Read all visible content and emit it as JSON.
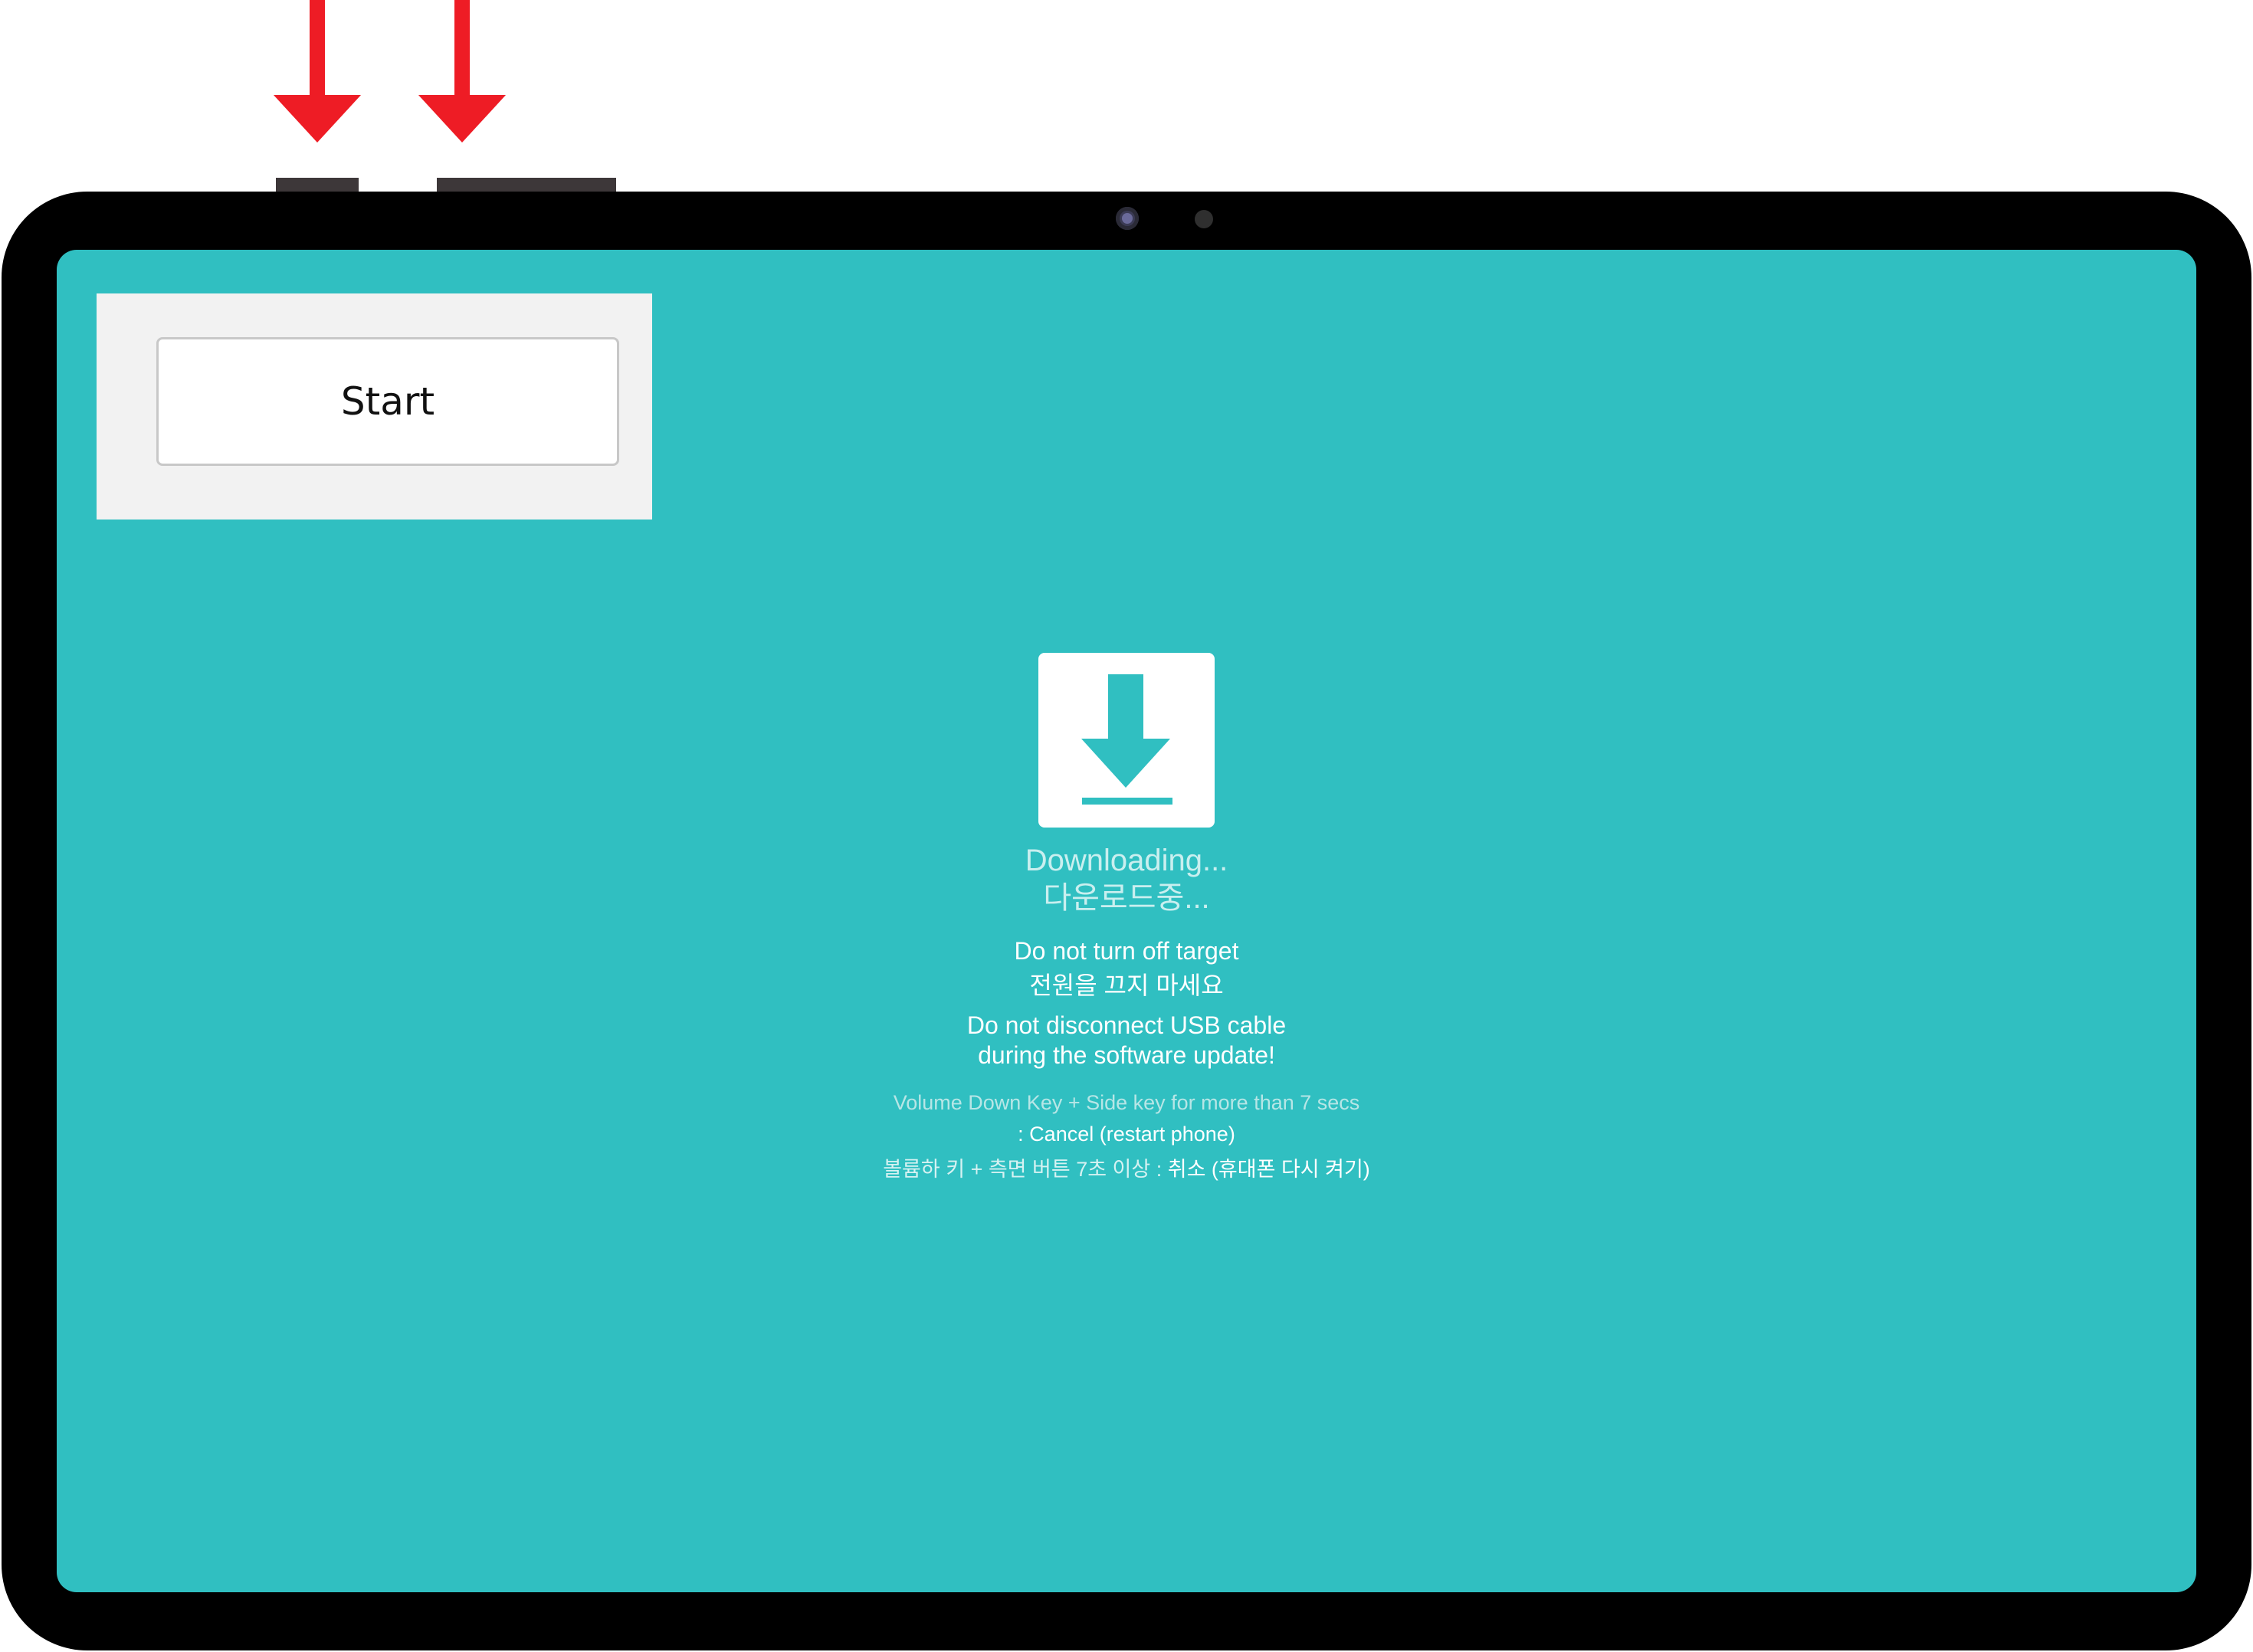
{
  "start_button": {
    "label": "Start"
  },
  "download_screen": {
    "icon": "download-arrow-icon",
    "status_en": "Downloading...",
    "status_ko": "다운로드중...",
    "warning_power_en": "Do not turn off target",
    "warning_power_ko": "전원을 끄지 마세요",
    "warning_usb_line1": "Do not disconnect USB cable",
    "warning_usb_line2": "during the software update!",
    "cancel_hint_en_line1": "Volume Down Key + Side key for more than 7 secs",
    "cancel_hint_en_line2": ": Cancel (restart phone)",
    "cancel_hint_ko_prefix": "볼륨하 키 + 측면 버튼 7초 이상 : ",
    "cancel_hint_ko_action": "취소 (휴대폰 다시 켜기)"
  },
  "indicators": {
    "arrow_color": "#ee1c25",
    "arrow_icon": "arrow-down-icon"
  },
  "colors": {
    "screen_background": "#30bfc1",
    "tablet_frame": "#000000",
    "side_button": "#3d3739"
  }
}
